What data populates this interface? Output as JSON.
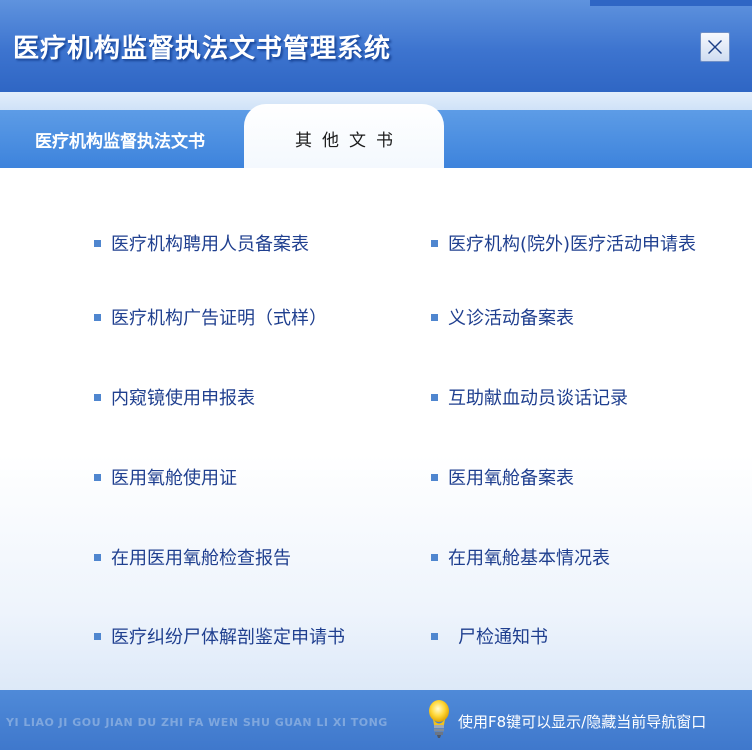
{
  "window": {
    "title": "医疗机构监督执法文书管理系统",
    "close_label": "X"
  },
  "tabs": [
    {
      "label": "医疗机构监督执法文书",
      "active": false
    },
    {
      "label": "其他文书",
      "active": true
    }
  ],
  "documents": {
    "left": [
      "医疗机构聘用人员备案表",
      "医疗机构广告证明（式样）",
      "内窥镜使用申报表",
      "医用氧舱使用证",
      "在用医用氧舱检查报告",
      "医疗纠纷尸体解剖鉴定申请书"
    ],
    "right": [
      "医疗机构(院外)医疗活动申请表",
      "义诊活动备案表",
      "互助献血动员谈话记录",
      "医用氧舱备案表",
      "在用氧舱基本情况表",
      "尸检通知书"
    ]
  },
  "footer": {
    "pinyin": "YI LIAO JI GOU JIAN DU ZHI FA WEN SHU GUAN LI XI TONG",
    "hint": "使用F8键可以显示/隐藏当前导航窗口",
    "hint_icon": "lightbulb-icon"
  },
  "colors": {
    "title_bar": "#3d74cf",
    "link_text": "#1f3f8f",
    "bullet": "#4f86cf",
    "bottom_bar": "#3f78cc"
  }
}
